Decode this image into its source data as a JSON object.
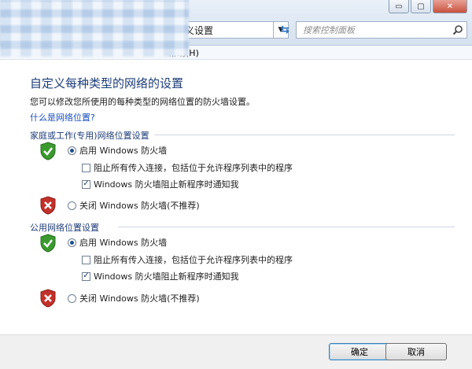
{
  "window": {
    "address_text": "义设置",
    "search_placeholder": "搜索控制面板",
    "controls": {
      "minimize": "▭",
      "maximize": "▢",
      "close": "✕"
    }
  },
  "menu": {
    "help": "帮助(H)"
  },
  "page": {
    "title": "自定义每种类型的网络的设置",
    "description": "您可以修改您所使用的每种类型的网络位置的防火墙设置。",
    "help_link": "什么是网络位置?"
  },
  "sections": [
    {
      "title": "家庭或工作(专用)网络位置设置",
      "enable_label": "启用 Windows 防火墙",
      "block_all_label": "阻止所有传入连接，包括位于允许程序列表中的程序",
      "block_all_checked": false,
      "notify_label": "Windows 防火墙阻止新程序时通知我",
      "notify_checked": true,
      "disable_label": "关闭 Windows 防火墙(不推荐)",
      "enabled": true
    },
    {
      "title": "公用网络位置设置",
      "enable_label": "启用 Windows 防火墙",
      "block_all_label": "阻止所有传入连接，包括位于允许程序列表中的程序",
      "block_all_checked": false,
      "notify_label": "Windows 防火墙阻止新程序时通知我",
      "notify_checked": true,
      "disable_label": "关闭 Windows 防火墙(不推荐)",
      "enabled": true
    }
  ],
  "icons": {
    "shield_ok": "shield-check-icon",
    "shield_off": "shield-x-icon",
    "check_mark": "✓"
  },
  "colors": {
    "shield_ok": "#3a9a2e",
    "shield_off": "#c3302a",
    "title": "#1e3d79",
    "link": "#1a4fbd"
  },
  "footer": {
    "ok_label": "确定",
    "cancel_label": "取消"
  }
}
